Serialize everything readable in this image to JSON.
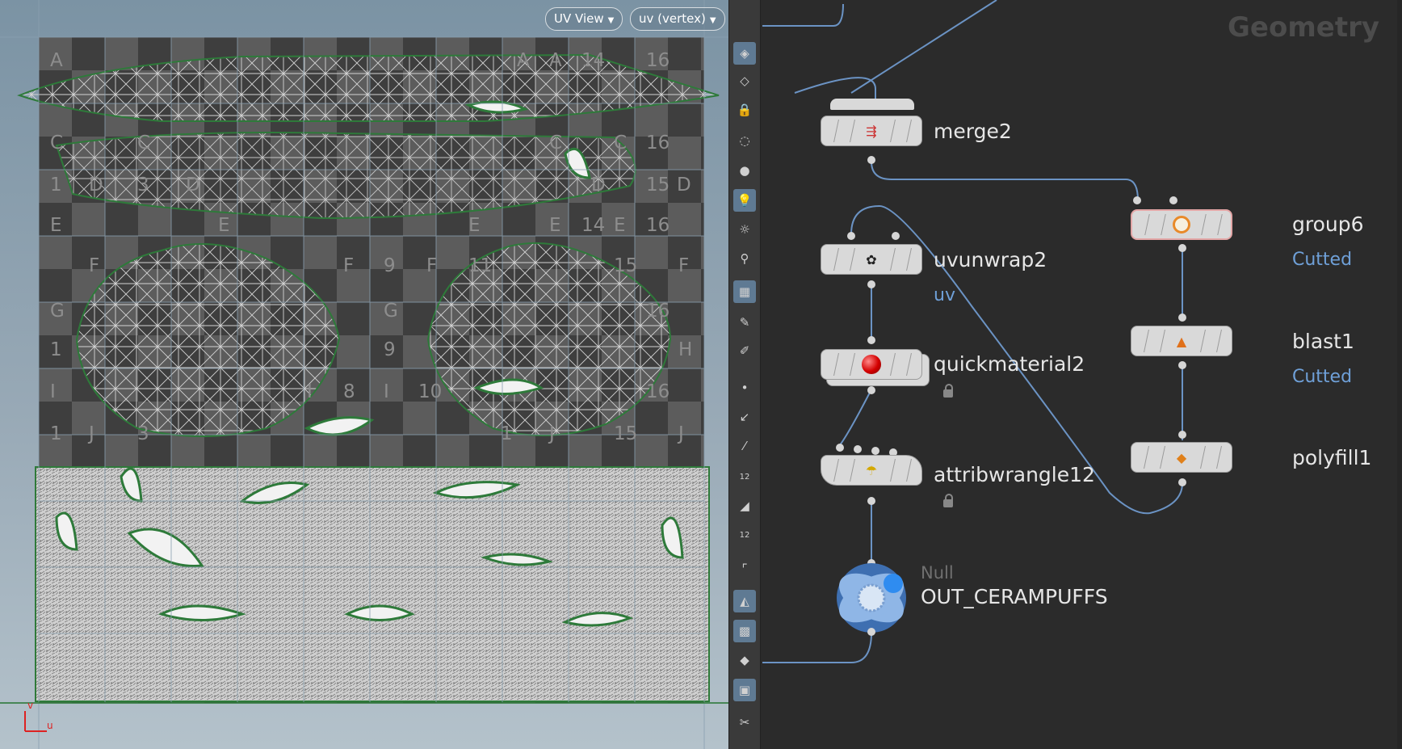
{
  "uv_view": {
    "view_mode": "UV View",
    "attribute": "uv (vertex)",
    "axis_v": "v",
    "axis_u": "u",
    "checker_labels": [
      "A",
      "A",
      "A",
      "14",
      "16",
      "C",
      "C",
      "C",
      "C",
      "16",
      "1",
      "D",
      "3",
      "D",
      "D",
      "15",
      "D",
      "E",
      "E",
      "E",
      "E",
      "14",
      "E",
      "16",
      "F",
      "F",
      "9",
      "F",
      "11",
      "15",
      "F",
      "G",
      "G",
      "16",
      "1",
      "9",
      "H",
      "I",
      "I",
      "8",
      "I",
      "10",
      "16",
      "1",
      "J",
      "3",
      "1",
      "J",
      "15",
      "J"
    ]
  },
  "toolbar": {
    "tools": [
      "uv-display",
      "uv-edit",
      "lock",
      "ghost",
      "sphere",
      "light",
      "bulb",
      "pin",
      "checker",
      "brush",
      "brush2",
      "dot",
      "select",
      "pick",
      "numbers",
      "paint",
      "numbers2",
      "corner",
      "eraser",
      "checker2",
      "diamond",
      "flatten",
      "scissors"
    ],
    "labels": {
      "num1": "12",
      "num2": "12"
    }
  },
  "network": {
    "context": "Geometry",
    "nodes": {
      "merge2": {
        "name": "merge2"
      },
      "group6": {
        "name": "group6",
        "comment": "Cutted"
      },
      "uvunwrap2": {
        "name": "uvunwrap2",
        "comment": "uv"
      },
      "blast1": {
        "name": "blast1",
        "comment": "Cutted"
      },
      "quickmaterial2": {
        "name": "quickmaterial2"
      },
      "polyfill1": {
        "name": "polyfill1"
      },
      "attribwrangle12": {
        "name": "attribwrangle12"
      },
      "out": {
        "type": "Null",
        "name": "OUT_CERAMPUFFS"
      }
    }
  },
  "colors": {
    "node_body": "#d9d9d9",
    "wire": "#6b93c4",
    "comment": "#6fa0d8",
    "uv_island_outline": "#2e7a3a",
    "active_tool": "#5f7a93",
    "null_node": "#5b8ccf"
  }
}
